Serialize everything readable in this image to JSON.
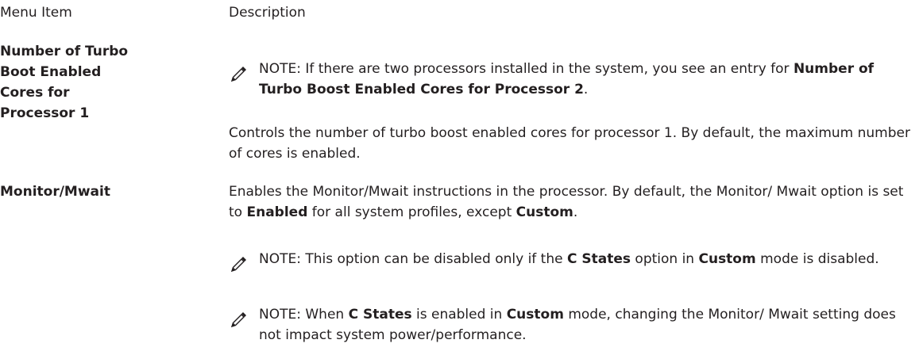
{
  "table_header": {
    "col_item": "Menu Item",
    "col_description": "Description"
  },
  "rows": [
    {
      "item_lines": [
        "Number of Turbo",
        "Boot Enabled",
        "Cores for",
        "Processor 1"
      ],
      "note": {
        "label": "NOTE:",
        "text_before": " If there are two processors installed in the system, you see an entry for ",
        "bold": "Number of Turbo Boost Enabled Cores for Processor 2",
        "text_after": "."
      },
      "description": "Controls the number of turbo boost enabled cores for processor 1. By default, the maximum number of cores is enabled."
    },
    {
      "item_lines": [
        "Monitor/Mwait"
      ],
      "description": {
        "part1": "Enables the Monitor/Mwait instructions in the processor. By default, the Monitor/ Mwait option is set to ",
        "bold1": "Enabled",
        "part2": " for all system profiles, except ",
        "bold2": "Custom",
        "part3": "."
      },
      "notes": [
        {
          "label": "NOTE:",
          "t1": " This option can be disabled only if the ",
          "b1": "C States",
          "t2": " option in ",
          "b2": "Custom",
          "t3": " mode is disabled."
        },
        {
          "label": "NOTE:",
          "t1": " When ",
          "b1": "C States",
          "t2": " is enabled in ",
          "b2": "Custom",
          "t3": " mode, changing the Monitor/ Mwait setting does not impact system power/performance."
        }
      ]
    }
  ],
  "icons": {
    "note": "pencil-note-icon"
  }
}
